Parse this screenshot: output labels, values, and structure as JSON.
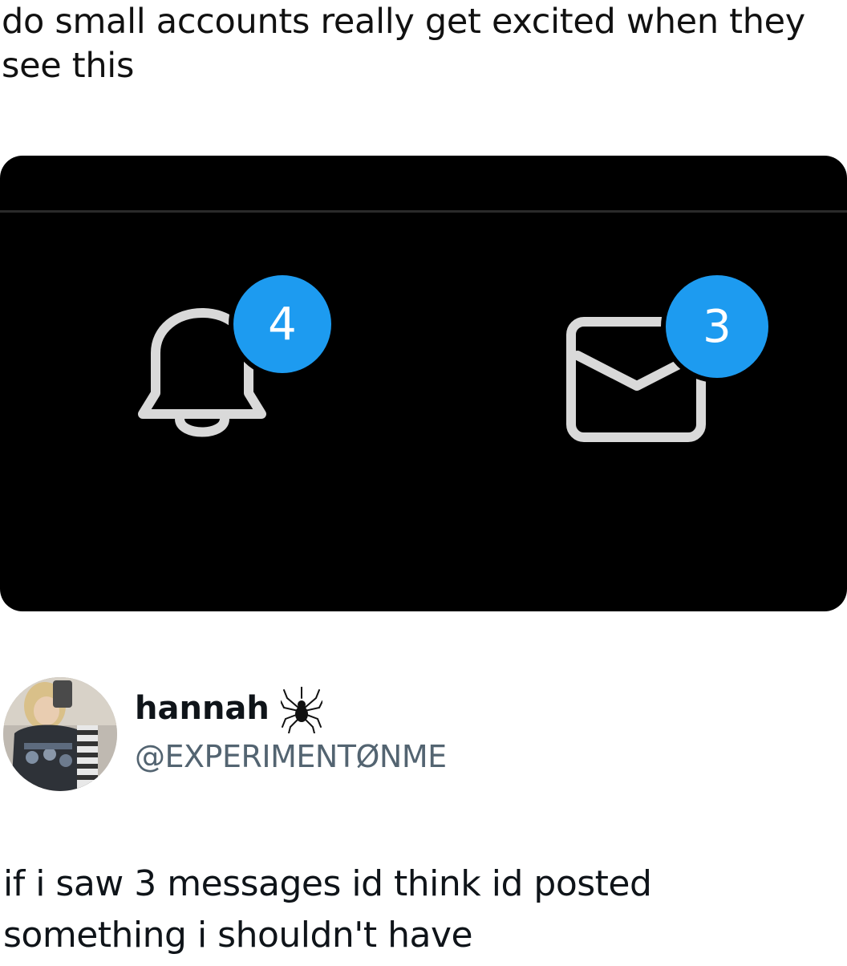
{
  "post": {
    "caption": "do small accounts really get excited when they see this"
  },
  "screenshot": {
    "notifications": {
      "icon": "bell-icon",
      "count": "4"
    },
    "messages": {
      "icon": "envelope-icon",
      "count": "3"
    },
    "colors": {
      "background": "#000000",
      "badge": "#1d9bf0",
      "icon": "#d9d9d9"
    }
  },
  "tweet": {
    "author": {
      "display_name": "hannah",
      "emoji_icon": "spider-icon",
      "handle": "@EXPERIMENTØNME"
    },
    "text": "if i saw 3 messages id think id posted something i shouldn't have"
  }
}
